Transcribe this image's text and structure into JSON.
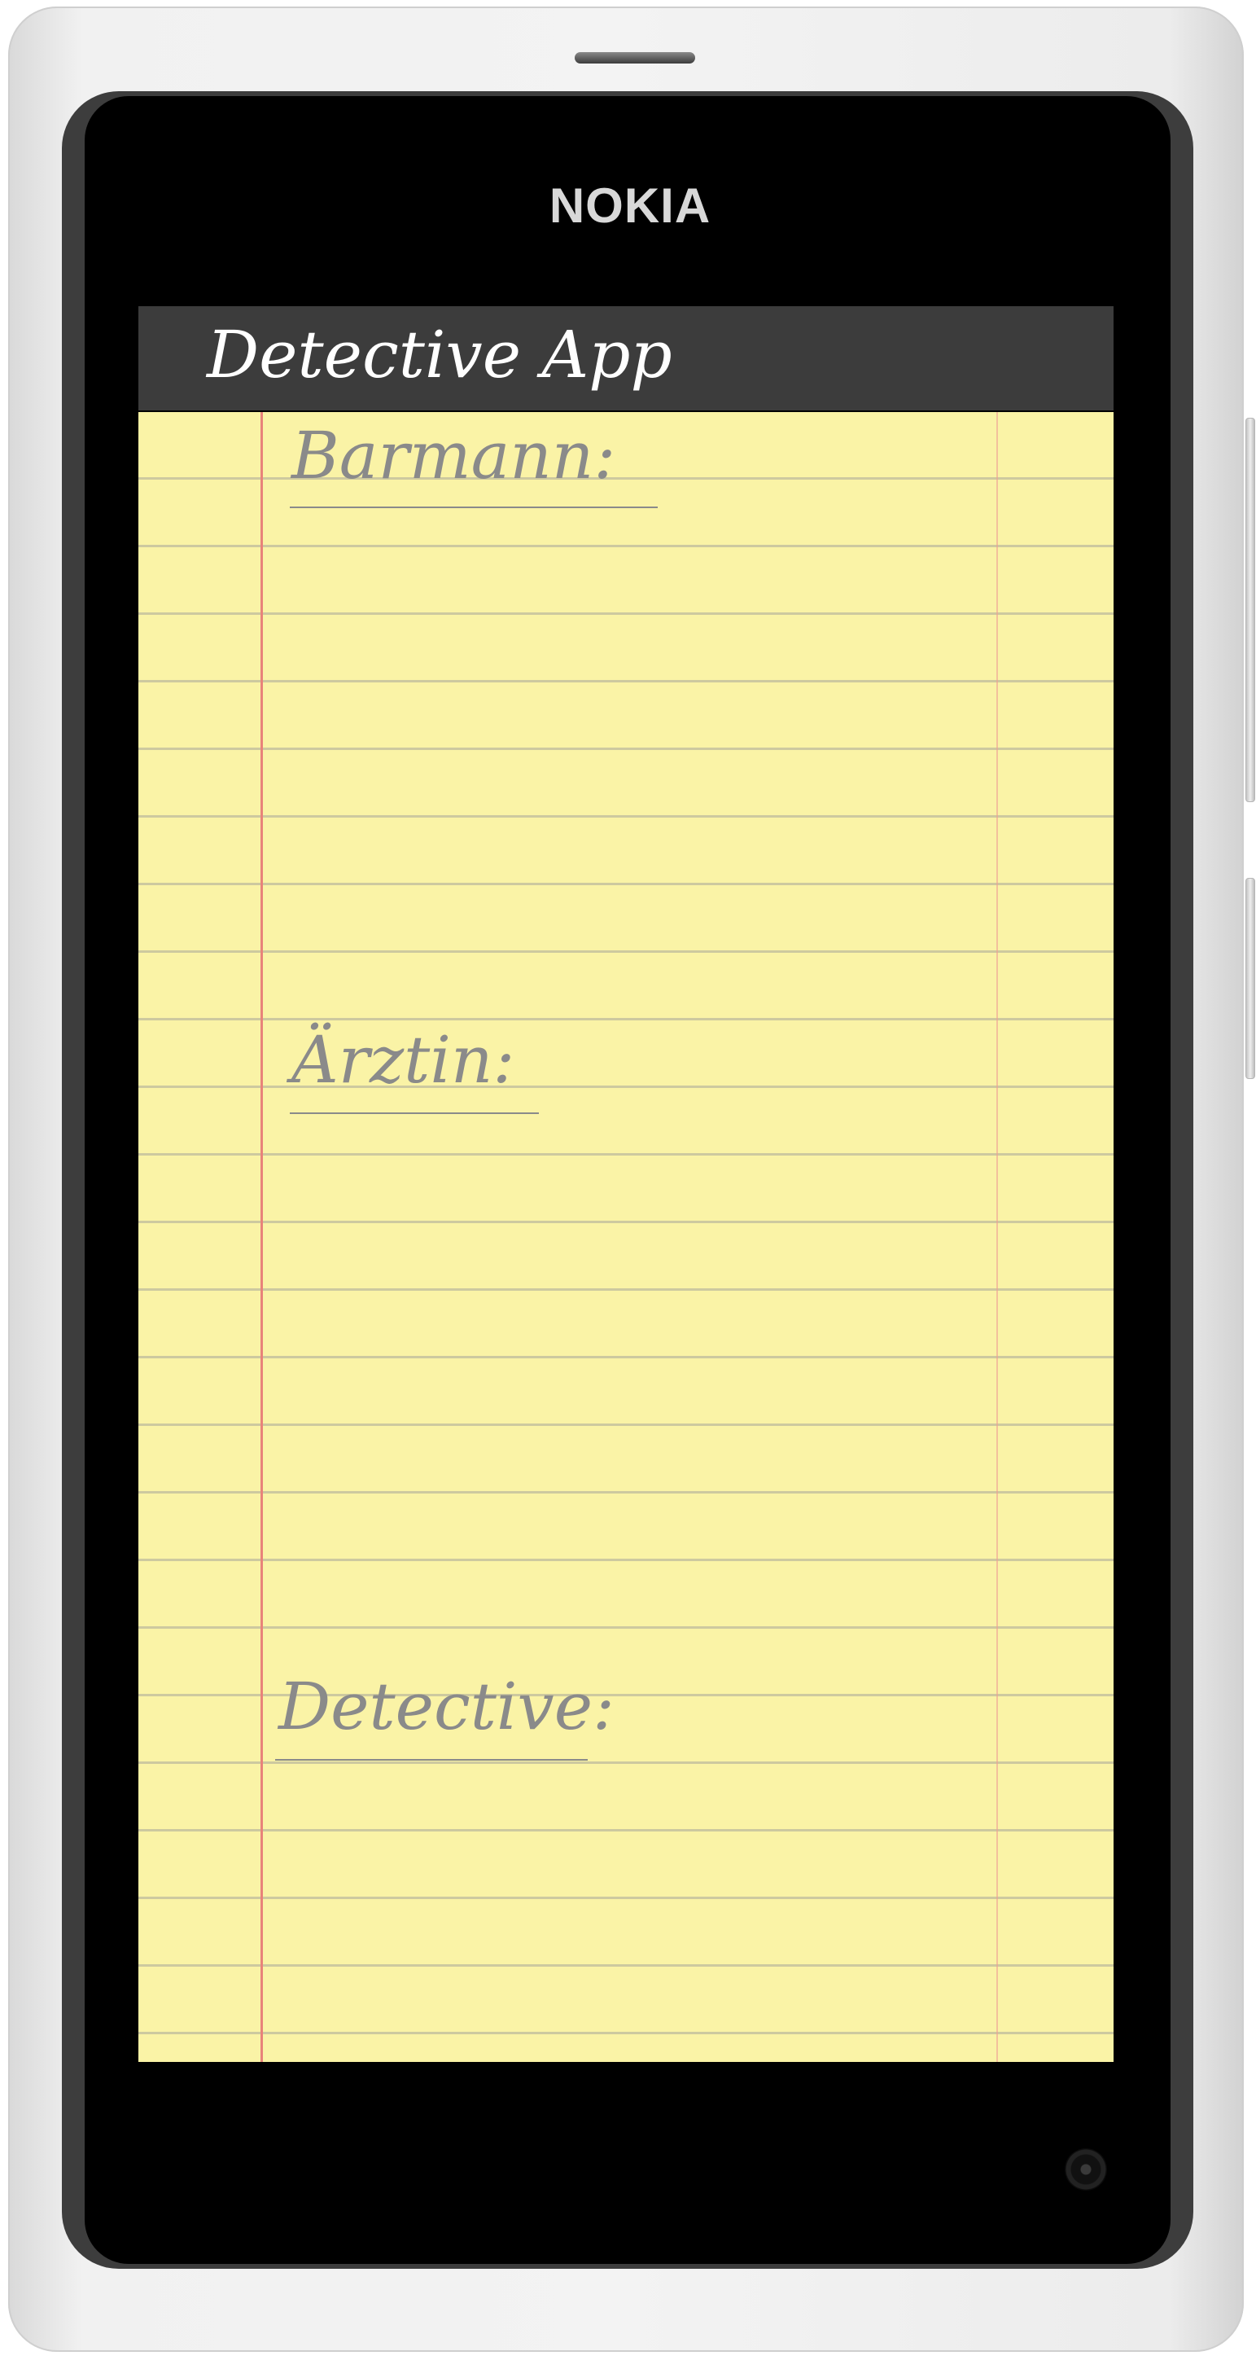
{
  "device": {
    "brand": "NOKIA"
  },
  "app": {
    "title": "Detective App"
  },
  "notes": {
    "labels": [
      {
        "text": "Barmann:"
      },
      {
        "text": "Ärztin:"
      },
      {
        "text": "Detective:"
      }
    ]
  },
  "colors": {
    "titlebar": "#3c3c3c",
    "paper": "#faf3a6",
    "margin_line": "#e8837a",
    "label_text": "#8a8a8a"
  }
}
